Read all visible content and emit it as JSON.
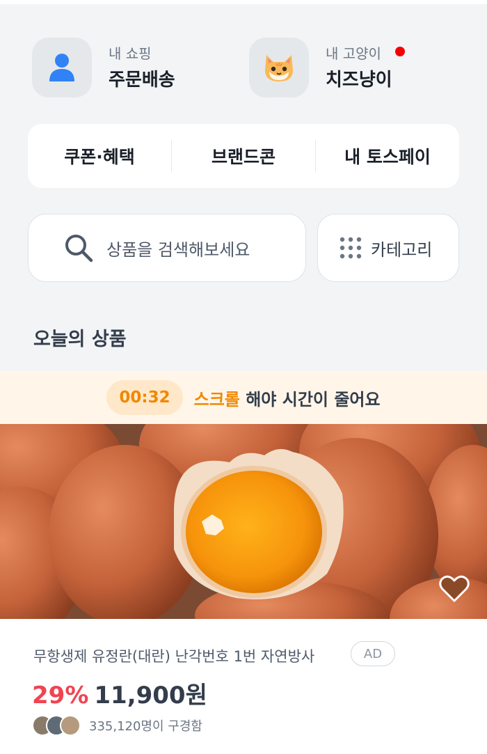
{
  "shortcuts": [
    {
      "label": "내 쇼핑",
      "title": "주문배송",
      "icon": "person-icon"
    },
    {
      "label": "내 고양이",
      "title": "치즈냥이",
      "icon": "cat-avatar-icon",
      "has_notification": true
    }
  ],
  "menu": [
    "쿠폰·혜택",
    "브랜드콘",
    "내 토스페이"
  ],
  "search": {
    "placeholder": "상품을 검색해보세요",
    "icon": "search-icon"
  },
  "category": {
    "label": "카테고리",
    "icon": "grid-dots-icon"
  },
  "section_title": "오늘의 상품",
  "timer": {
    "time": "00:32",
    "highlight": "스크롤",
    "message": " 해야 시간이 줄어요"
  },
  "product": {
    "image": "egg-photo",
    "title": "무항생제 유정란(대란) 난각번호 1번 자연방사",
    "ad_label": "AD",
    "discount": "29%",
    "price": "11,900원",
    "buyers": "335,120명이 구경함",
    "favorite_icon": "heart-icon"
  },
  "colors": {
    "accent": "#f08700",
    "discount": "#f04452",
    "background": "#f2f4f6",
    "brand_blue": "#3182f6"
  }
}
